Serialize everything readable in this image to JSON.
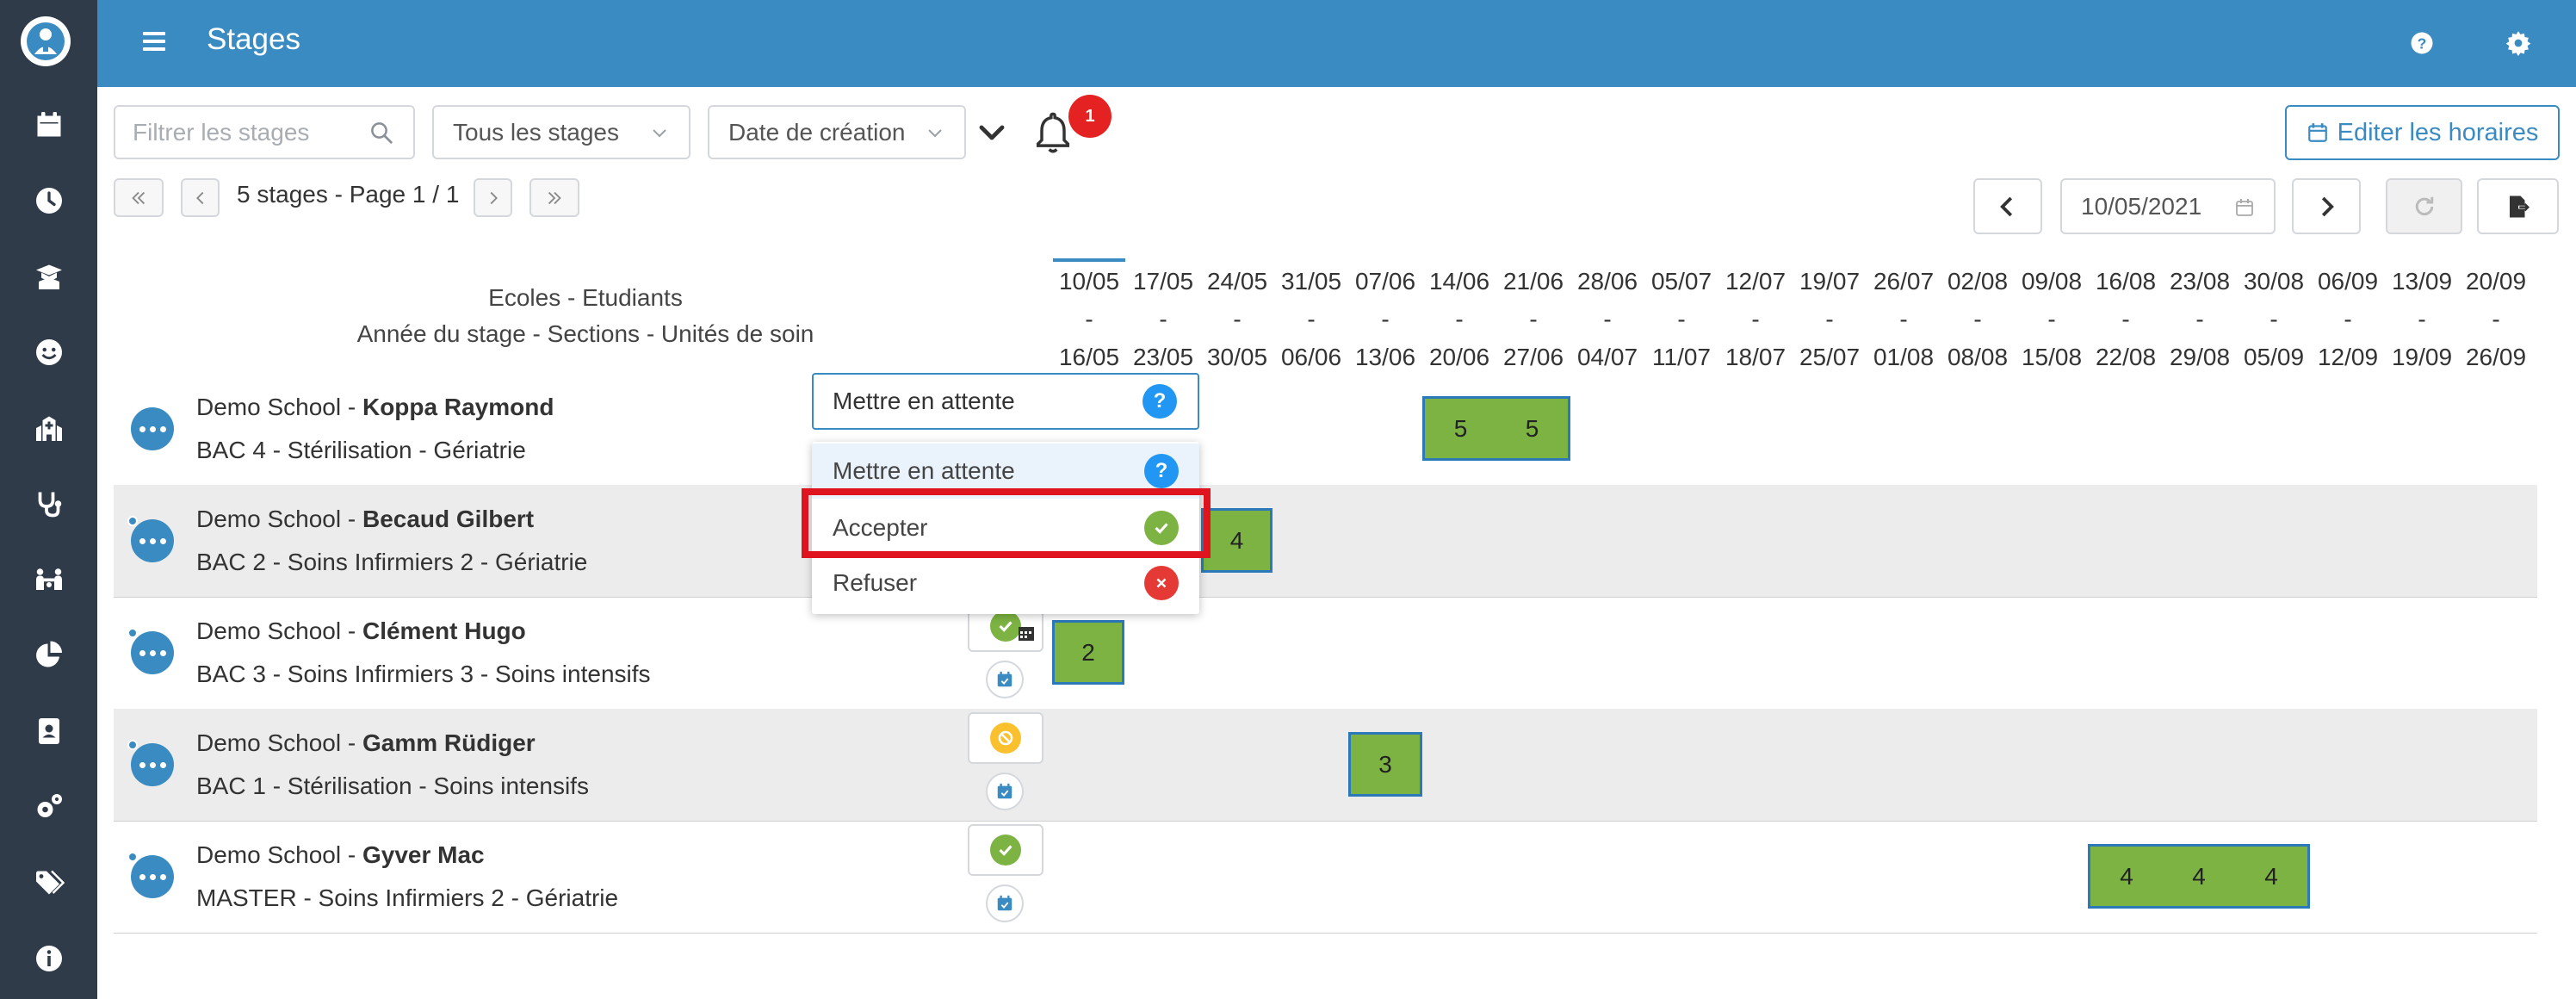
{
  "header": {
    "title": "Stages"
  },
  "toolbar": {
    "search_placeholder": "Filtrer les stages",
    "filter_select": "Tous les stages",
    "sort_select": "Date de création",
    "notification_count": "1",
    "edit_button": "Editer les horaires"
  },
  "pagination": {
    "info": "5 stages - Page 1 / 1"
  },
  "date_nav": {
    "current_date": "10/05/2021"
  },
  "columns": {
    "head1": "Ecoles - Etudiants",
    "head2": "Année du stage - Sections - Unités de soin",
    "weeks": [
      {
        "start": "10/05",
        "sep": "-",
        "end": "16/05"
      },
      {
        "start": "17/05",
        "sep": "-",
        "end": "23/05"
      },
      {
        "start": "24/05",
        "sep": "-",
        "end": "30/05"
      },
      {
        "start": "31/05",
        "sep": "-",
        "end": "06/06"
      },
      {
        "start": "07/06",
        "sep": "-",
        "end": "13/06"
      },
      {
        "start": "14/06",
        "sep": "-",
        "end": "20/06"
      },
      {
        "start": "21/06",
        "sep": "-",
        "end": "27/06"
      },
      {
        "start": "28/06",
        "sep": "-",
        "end": "04/07"
      },
      {
        "start": "05/07",
        "sep": "-",
        "end": "11/07"
      },
      {
        "start": "12/07",
        "sep": "-",
        "end": "18/07"
      },
      {
        "start": "19/07",
        "sep": "-",
        "end": "25/07"
      },
      {
        "start": "26/07",
        "sep": "-",
        "end": "01/08"
      },
      {
        "start": "02/08",
        "sep": "-",
        "end": "08/08"
      },
      {
        "start": "09/08",
        "sep": "-",
        "end": "15/08"
      },
      {
        "start": "16/08",
        "sep": "-",
        "end": "22/08"
      },
      {
        "start": "23/08",
        "sep": "-",
        "end": "29/08"
      },
      {
        "start": "30/08",
        "sep": "-",
        "end": "05/09"
      },
      {
        "start": "06/09",
        "sep": "-",
        "end": "12/09"
      },
      {
        "start": "13/09",
        "sep": "-",
        "end": "19/09"
      },
      {
        "start": "20/09",
        "sep": "-",
        "end": "26/09"
      }
    ]
  },
  "rows": [
    {
      "school": "Demo School - ",
      "student": "Koppa Raymond",
      "details": "BAC 4 - Stérilisation - Gériatrie",
      "status": "pending",
      "bar_labels": [
        "5",
        "5"
      ]
    },
    {
      "school": "Demo School - ",
      "student": "Becaud Gilbert",
      "details": "BAC 2 - Soins Infirmiers 2 - Gériatrie",
      "status": "accepted",
      "bar_labels": [
        "4"
      ]
    },
    {
      "school": "Demo School - ",
      "student": "Clément Hugo",
      "details": "BAC 3 - Soins Infirmiers 3 - Soins intensifs",
      "status": "accepted",
      "bar_labels": [
        "2"
      ]
    },
    {
      "school": "Demo School - ",
      "student": "Gamm Rüdiger",
      "details": "BAC 1 - Stérilisation - Soins intensifs",
      "status": "cancelled",
      "bar_labels": [
        "3"
      ]
    },
    {
      "school": "Demo School - ",
      "student": "Gyver Mac",
      "details": "MASTER - Soins Infirmiers 2 - Gériatrie",
      "status": "accepted",
      "bar_labels": [
        "4",
        "4",
        "4"
      ]
    }
  ],
  "status_dropdown": {
    "selected": "Mettre en attente",
    "options": [
      "Mettre en attente",
      "Accepter",
      "Refuser"
    ],
    "highlighted_option": "Accepter"
  },
  "colors": {
    "header": "#3b8bc3",
    "sidebar": "#2f3b48",
    "bar_fill": "#7cb342",
    "bar_border": "#2b79b8",
    "highlight": "#e0141e",
    "badge": "#e52222"
  },
  "icons": {
    "sidebar": [
      "calendar-icon",
      "clock-icon",
      "graduate-icon",
      "smiley-icon",
      "hospital-icon",
      "stethoscope-icon",
      "people-icon",
      "pie-chart-icon",
      "contact-card-icon",
      "cogs-icon",
      "tags-icon",
      "info-icon"
    ],
    "header": [
      "menu-icon",
      "help-icon",
      "settings-icon"
    ]
  }
}
